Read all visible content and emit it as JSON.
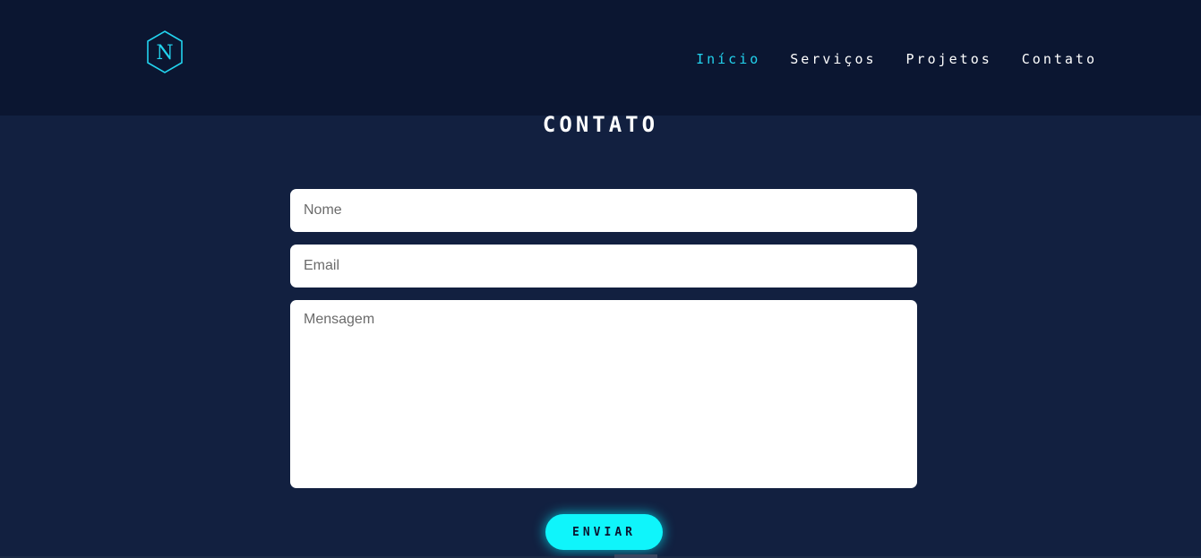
{
  "header": {
    "logo_letter": "N",
    "nav": [
      {
        "label": "Início",
        "active": true
      },
      {
        "label": "Serviços",
        "active": false
      },
      {
        "label": "Projetos",
        "active": false
      },
      {
        "label": "Contato",
        "active": false
      }
    ]
  },
  "contact": {
    "title": "CONTATO",
    "name_placeholder": "Nome",
    "email_placeholder": "Email",
    "message_placeholder": "Mensagem",
    "submit_label": "ENVIAR"
  },
  "colors": {
    "accent": "#22d3ee",
    "button": "#0ff5fb",
    "header_bg": "#0b1631",
    "page_bg": "#122040"
  },
  "icons": {
    "logo": "hexagon-n-logo-icon"
  }
}
